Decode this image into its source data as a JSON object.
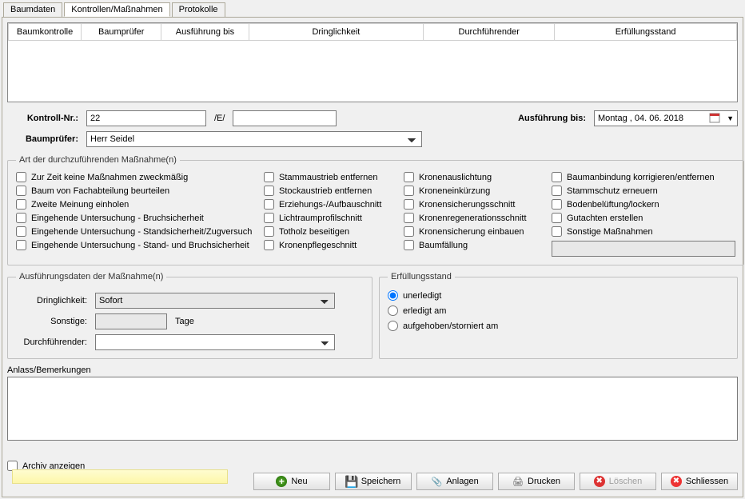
{
  "tabs": {
    "baumdaten": "Baumdaten",
    "kontrollen": "Kontrollen/Maßnahmen",
    "protokolle": "Protokolle"
  },
  "grid": {
    "cols": {
      "baumkontrolle": "Baumkontrolle",
      "baumpruefer": "Baumprüfer",
      "ausfuehrung_bis": "Ausführung bis",
      "dringlichkeit": "Dringlichkeit",
      "durchfuehrender": "Durchführender",
      "erfuellungsstand": "Erfüllungsstand"
    }
  },
  "form": {
    "kontroll_nr_label": "Kontroll-Nr.:",
    "kontroll_nr_value": "22",
    "kontroll_nr_sep": "/E/",
    "kontroll_nr_suffix": "",
    "ausfuehrung_bis_label": "Ausführung bis:",
    "date_value": "Montag  , 04. 06. 2018",
    "baumpruefer_label": "Baumprüfer:",
    "baumpruefer_value": "Herr Seidel"
  },
  "actions_group": {
    "legend": "Art der durchzuführenden Maßnahme(n)",
    "col1": [
      "Zur Zeit keine Maßnahmen zweckmäßig",
      "Baum von Fachabteilung beurteilen",
      "Zweite Meinung einholen",
      "Eingehende Untersuchung - Bruchsicherheit",
      "Eingehende Untersuchung - Standsicherheit/Zugversuch",
      "Eingehende Untersuchung - Stand- und Bruchsicherheit"
    ],
    "col2": [
      "Stammaustrieb entfernen",
      "Stockaustrieb entfernen",
      "Erziehungs-/Aufbauschnitt",
      "Lichtraumprofilschnitt",
      "Totholz beseitigen",
      "Kronenpflegeschnitt"
    ],
    "col3": [
      "Kronenauslichtung",
      "Kroneneinkürzung",
      "Kronensicherungsschnitt",
      "Kronenregenerationsschnitt",
      "Kronensicherung einbauen",
      "Baumfällung"
    ],
    "col4": [
      "Baumanbindung korrigieren/entfernen",
      "Stammschutz erneuern",
      "Bodenbelüftung/lockern",
      "Gutachten erstellen",
      "Sonstige Maßnahmen"
    ]
  },
  "exec_group": {
    "legend": "Ausführungsdaten der Maßnahme(n)",
    "dringlichkeit_label": "Dringlichkeit:",
    "dringlichkeit_value": "Sofort",
    "sonstige_label": "Sonstige:",
    "sonstige_value": "",
    "sonstige_suffix": "Tage",
    "durchfuehrender_label": "Durchführender:",
    "durchfuehrender_value": ""
  },
  "status_group": {
    "legend": "Erfüllungsstand",
    "unerledigt": "unerledigt",
    "erledigt_am": "erledigt am",
    "aufgehoben": "aufgehoben/storniert am"
  },
  "remarks": {
    "label": "Anlass/Bemerkungen",
    "value": ""
  },
  "bottom": {
    "archiv": "Archiv anzeigen",
    "neu": "Neu",
    "speichern": "Speichern",
    "anlagen": "Anlagen",
    "drucken": "Drucken",
    "loeschen": "Löschen",
    "schliessen": "Schliessen"
  }
}
